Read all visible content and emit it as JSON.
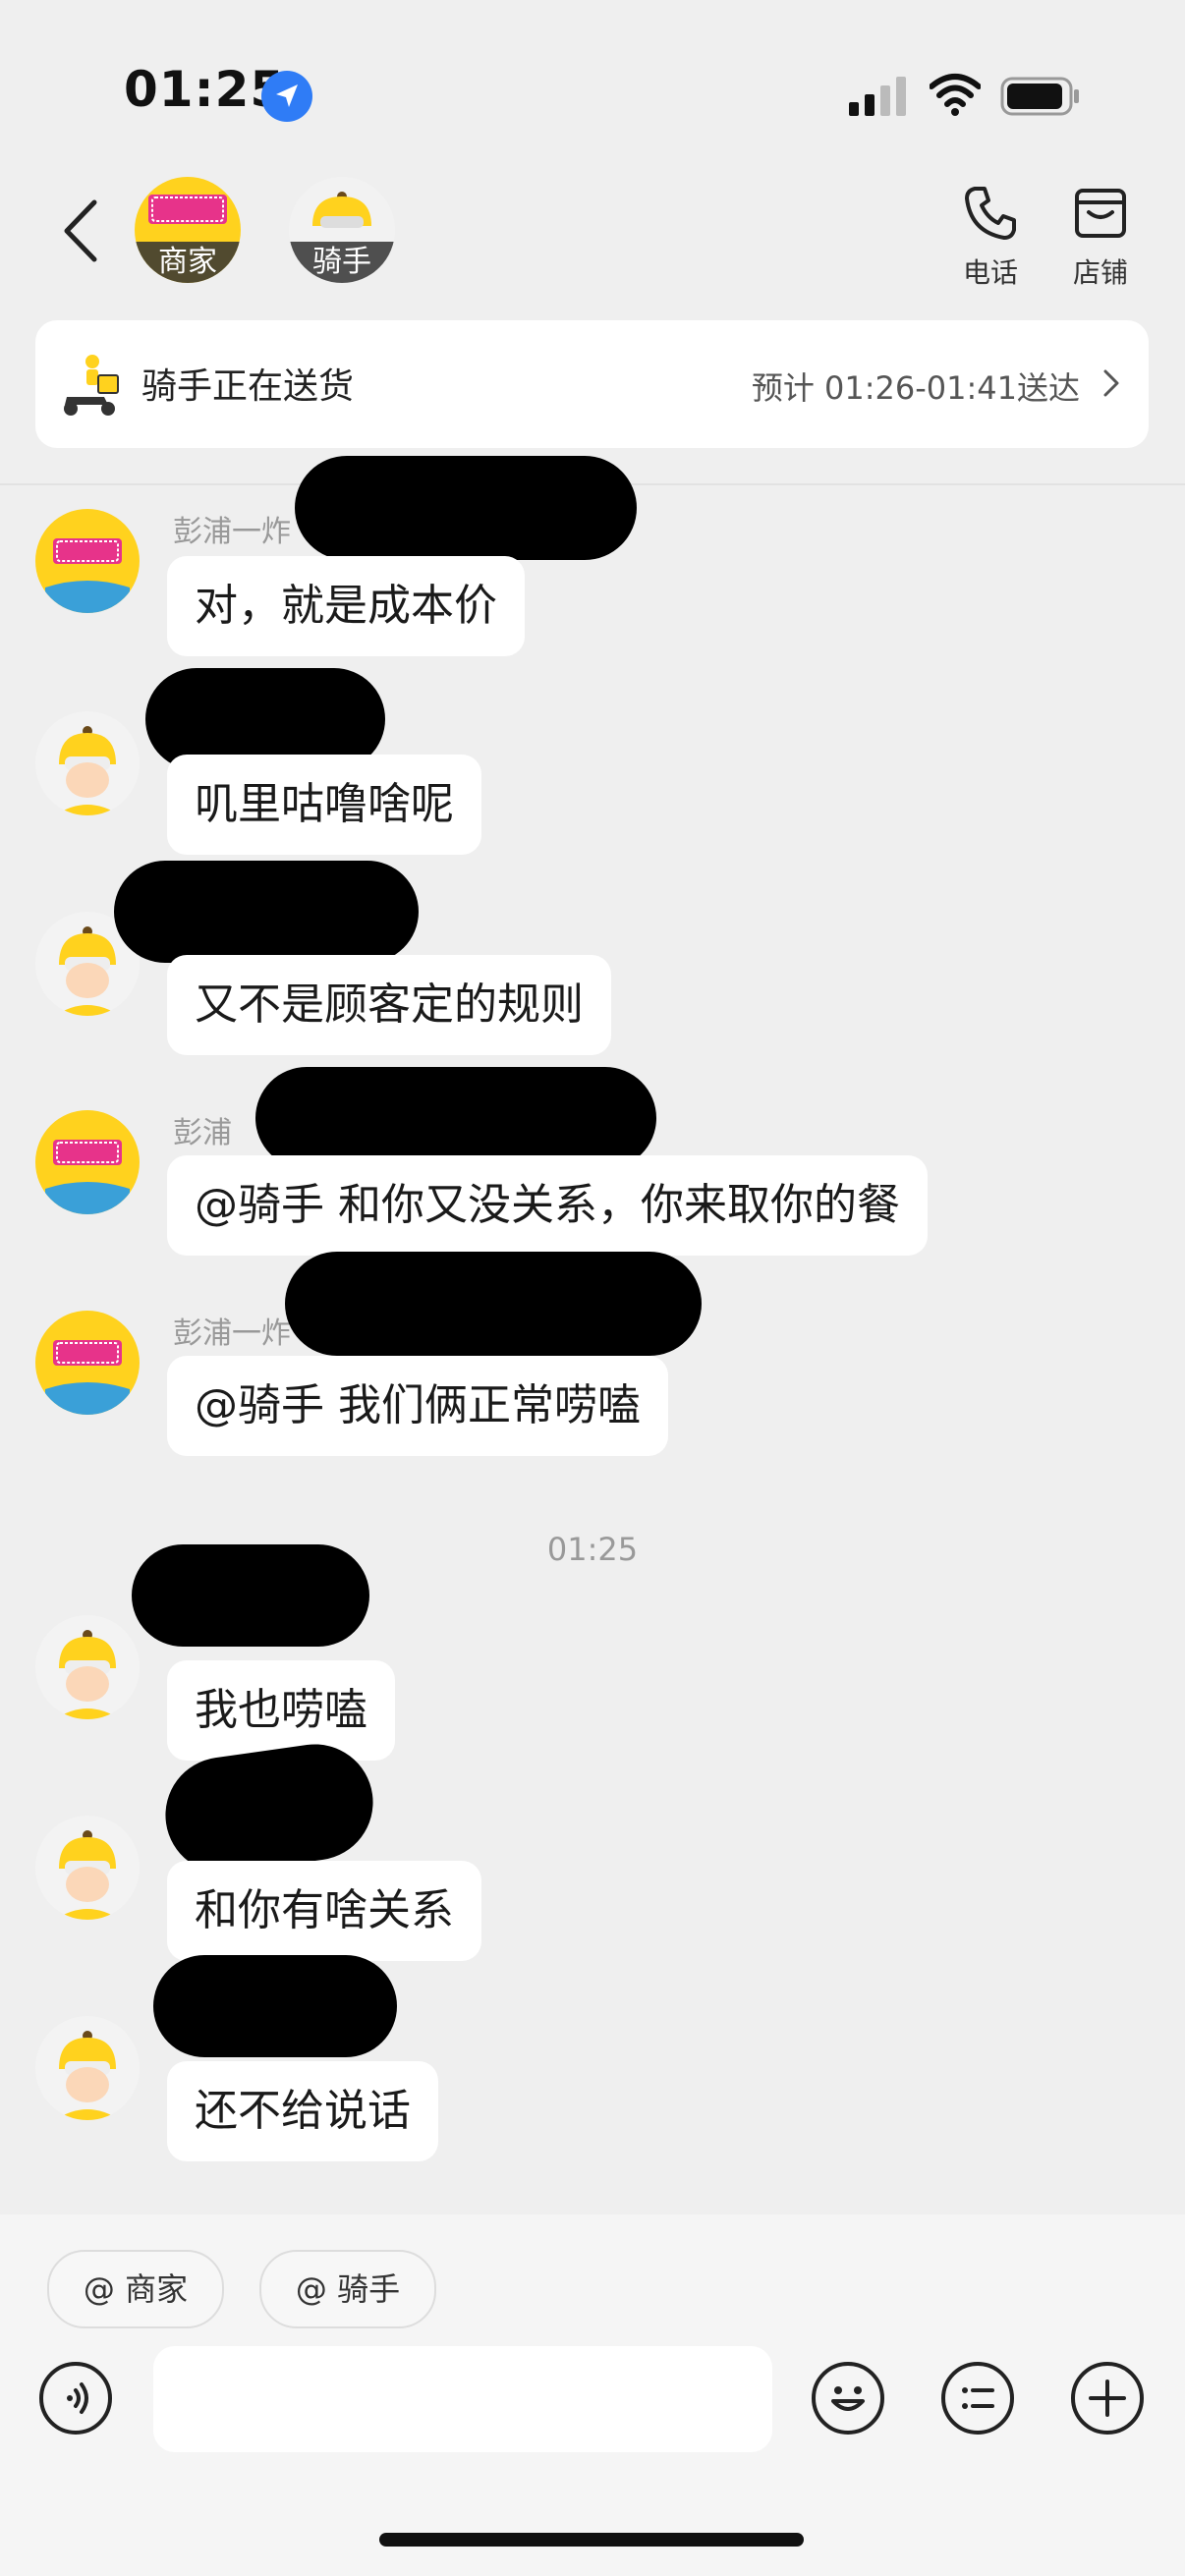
{
  "status_bar": {
    "time": "01:25"
  },
  "header": {
    "avatars": [
      {
        "label": "商家",
        "logo_text": "彭浦一炸"
      },
      {
        "label": "骑手"
      }
    ],
    "actions": [
      {
        "label": "电话",
        "icon": "phone-icon"
      },
      {
        "label": "店铺",
        "icon": "store-icon"
      }
    ]
  },
  "delivery_status": {
    "title": "骑手正在送货",
    "eta": "预计 01:26-01:41送达"
  },
  "messages": [
    {
      "role": "merchant",
      "sender": "彭浦一炸",
      "text": "对，就是成本价"
    },
    {
      "role": "rider",
      "sender": "",
      "text": "叽里咕噜啥呢"
    },
    {
      "role": "rider",
      "sender": "",
      "text": "又不是顾客定的规则"
    },
    {
      "role": "merchant",
      "sender": "彭浦",
      "text": "@骑手 和你又没关系，你来取你的餐"
    },
    {
      "role": "merchant",
      "sender": "彭浦一炸",
      "text": "@骑手 我们俩正常唠嗑"
    },
    {
      "role": "rider",
      "sender": "",
      "text": "我也唠嗑"
    },
    {
      "role": "rider",
      "sender": "",
      "text": "和你有啥关系"
    },
    {
      "role": "rider",
      "sender": "",
      "text": "还不给说话"
    }
  ],
  "timestamp": "01:25",
  "quick_mentions": [
    "@ 商家",
    "@ 骑手"
  ],
  "input": {
    "placeholder": ""
  },
  "colors": {
    "brand_yellow": "#ffd21e",
    "location_blue": "#2f7cf6"
  }
}
